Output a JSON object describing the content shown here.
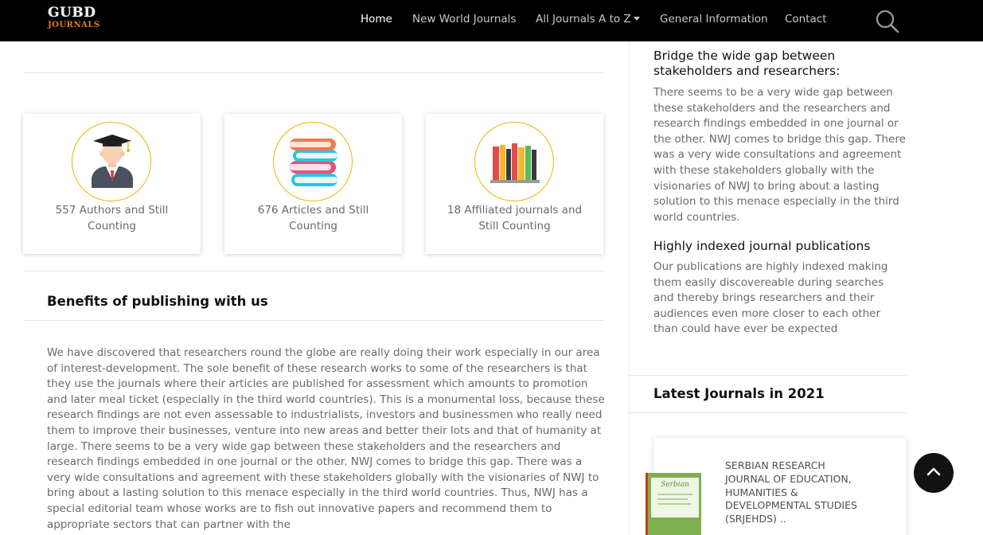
{
  "brand": {
    "logo_top": "GUBD",
    "logo_bottom": "JOURNALS"
  },
  "nav": {
    "items": [
      {
        "label": "Home",
        "active": true
      },
      {
        "label": "New World Journals",
        "active": false
      },
      {
        "label": "All Journals A to Z",
        "active": false,
        "dropdown": true
      },
      {
        "label": "General Information",
        "active": false
      },
      {
        "label": "Contact",
        "active": false
      }
    ],
    "search_icon": "search-icon"
  },
  "stats": [
    {
      "icon": "graduate-icon",
      "text": "557 Authors and Still Counting"
    },
    {
      "icon": "books-stack-icon",
      "text": "676 Articles and Still Counting"
    },
    {
      "icon": "bookshelf-icon",
      "text": "18 Affiliated journals and Still Counting"
    }
  ],
  "benefits": {
    "title": "Benefits of publishing with us",
    "body": "We have discovered that researchers round the globe are really doing their work especially in our area of interest-development. The sole benefit of these research works to some of the researchers is that they use the journals where their articles are published for assessment which amounts to promotion and later meal ticket (especially in the third world countries). This is a monumental loss, because these research findings are not even assessable to industrialists, investors and businessmen who really need them to improve their businesses, venture into new areas and better their lots and that of humanity at large. There seems to be a very wide gap between these stakeholders and the researchers and research findings embedded in one journal or the other. NWJ comes to bridge this gap. There was a very wide consultations and agreement with these stakeholders globally with the visionaries of NWJ to bring about a lasting solution to this menace especially in the third world countries. Thus, NWJ has a special editorial team whose works are to fish out innovative papers and recommend them to appropriate sectors that can partner with the"
  },
  "sidebar": {
    "blocks": [
      {
        "heading": "Bridge the wide gap between stakeholders and researchers:",
        "text": "There seems to be a very wide gap between these stakeholders and the researchers and research findings embedded in one journal or the other. NWJ comes to bridge this gap. There was a very wide consultations and agreement with these stakeholders globally with the visionaries of NWJ to bring about a lasting solution to this menace especially in the third world countries."
      },
      {
        "heading": "Highly indexed journal publications",
        "text": "Our publications are highly indexed making them easily discovereable during searches and thereby brings researchers and their audiences even more closer to each other than could have ever be expected"
      }
    ],
    "latest_title": "Latest Journals in 2021",
    "latest": [
      {
        "cover_title": "Serbian",
        "title": "SERBIAN RESEARCH JOURNAL OF EDUCATION, HUMANITIES & DEVELOPMENTAL STUDIES (SRJEHDS) .."
      }
    ]
  },
  "back_to_top_icon": "chevron-up-icon",
  "colors": {
    "navbar": "#000000",
    "accent_ring": "#f0b400",
    "back_to_top": "#121212"
  }
}
